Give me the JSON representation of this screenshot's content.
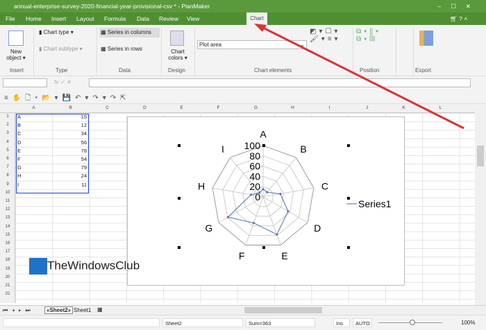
{
  "window": {
    "title": "annual-enterprise-survey-2020-financial-year-provisional-csv * - PlanMaker"
  },
  "menu": [
    "File",
    "Home",
    "Insert",
    "Layout",
    "Formula",
    "Data",
    "Review",
    "View"
  ],
  "active_tab": "Chart",
  "ribbon": {
    "new_object": "New object ▾",
    "chart_type": "Chart type ▾",
    "chart_subtype": "Chart subtype ▾",
    "series_columns": "Series in columns",
    "series_rows": "Series in rows",
    "chart_colors": "Chart colors ▾",
    "element_select": "Plot area",
    "groups": [
      "Insert",
      "Type",
      "Data",
      "Design",
      "Chart elements",
      "Position",
      "Export"
    ]
  },
  "columns": [
    "A",
    "B",
    "C",
    "D",
    "E",
    "F",
    "G",
    "H",
    "I",
    "J",
    "K",
    "L"
  ],
  "rows": [
    "1",
    "2",
    "3",
    "4",
    "5",
    "6",
    "7",
    "8",
    "9",
    "10",
    "11",
    "12",
    "13",
    "14",
    "15",
    "16",
    "17",
    "18",
    "19",
    "20",
    "21",
    "22"
  ],
  "cells": [
    [
      "A",
      "15"
    ],
    [
      "B",
      "12"
    ],
    [
      "C",
      "34"
    ],
    [
      "D",
      "56"
    ],
    [
      "E",
      "78"
    ],
    [
      "F",
      "54"
    ],
    [
      "G",
      "79"
    ],
    [
      "H",
      "24"
    ],
    [
      "I",
      "11"
    ]
  ],
  "chart_data": {
    "type": "radar",
    "categories": [
      "A",
      "B",
      "C",
      "D",
      "E",
      "F",
      "G",
      "H",
      "I"
    ],
    "series": [
      {
        "name": "Series1",
        "values": [
          15,
          12,
          34,
          56,
          78,
          54,
          79,
          24,
          11
        ]
      }
    ],
    "ticks": [
      "0",
      "20",
      "40",
      "60",
      "80",
      "100"
    ],
    "range": [
      0,
      100
    ],
    "legend": "right",
    "series_color": "#4a6fa5"
  },
  "sheets": [
    "«Sheet2»",
    "Sheet1"
  ],
  "status": {
    "sheet": "Sheet2",
    "sum": "Sum=363",
    "mode": "Ins",
    "calc": "AUTO",
    "zoom": "100%"
  },
  "watermark": "TheWindowsClub"
}
